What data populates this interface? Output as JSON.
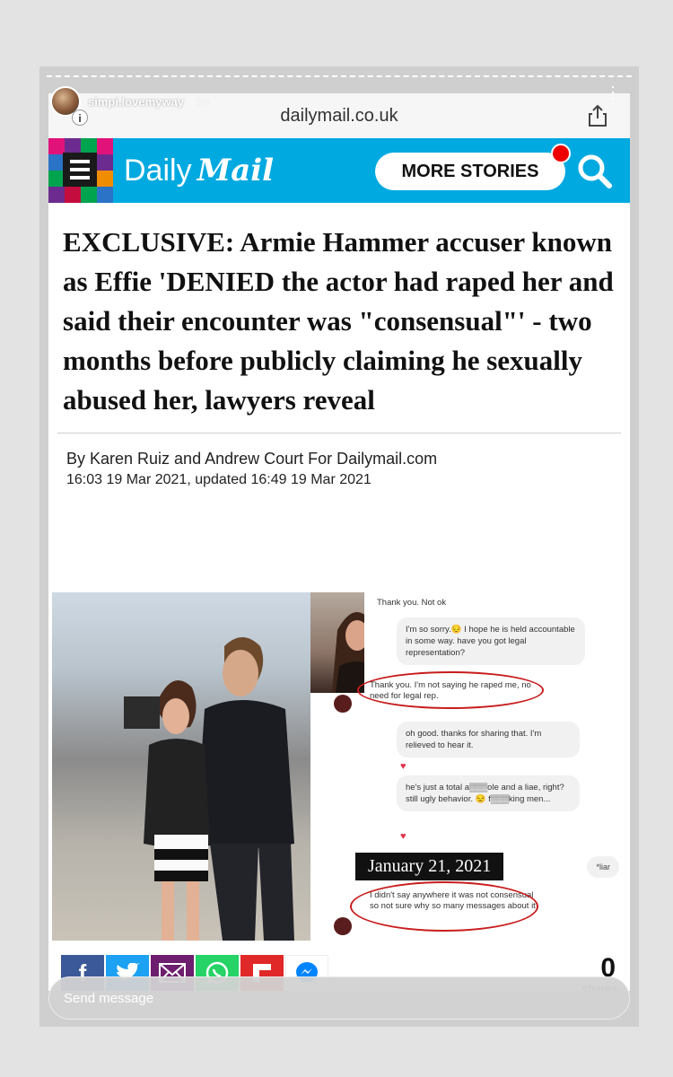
{
  "story": {
    "username": "simpi.lovemyway",
    "time_ago": "3m",
    "reply_placeholder": "Send message"
  },
  "browser": {
    "url": "dailymail.co.uk"
  },
  "site": {
    "brand_daily": "Daily",
    "brand_mail": "Mail",
    "more_stories": "MORE STORIES",
    "accent_color": "#00a9e0"
  },
  "article": {
    "headline": "EXCLUSIVE: Armie Hammer accuser known as Effie 'DENIED the actor had raped her and said their encounter was \"consensual\"' - two months before publicly claiming he sexually abused her, lawyers reveal",
    "byline": "By Karen Ruiz and Andrew Court For Dailymail.com",
    "timestamp": "16:03 19 Mar 2021, updated 16:49 19 Mar 2021"
  },
  "chat": {
    "messages": [
      {
        "dir": "out",
        "text": "Thank you. Not ok"
      },
      {
        "dir": "in",
        "text": "I'm so sorry.😔 I hope he is held accountable in some way. have you got legal representation?"
      },
      {
        "dir": "out",
        "text": "Thank you. I'm not saying he raped me, no need for legal rep."
      },
      {
        "dir": "in",
        "text": "oh good. thanks for sharing that. I'm relieved to hear it."
      },
      {
        "dir": "in",
        "text": "he's just a total a▒▒▒ole and a liae, right? still ugly behavior. 😒 f▒▒▒king men..."
      },
      {
        "dir": "out",
        "text": "I didn't say anywhere it was not consensual so not sure why so many messages about it"
      }
    ],
    "date_label": "January 21, 2021",
    "liar_label": "*liar"
  },
  "share": {
    "count": "0",
    "label": "shares",
    "buttons": [
      "facebook",
      "twitter",
      "email",
      "whatsapp",
      "flipboard",
      "messenger"
    ]
  }
}
